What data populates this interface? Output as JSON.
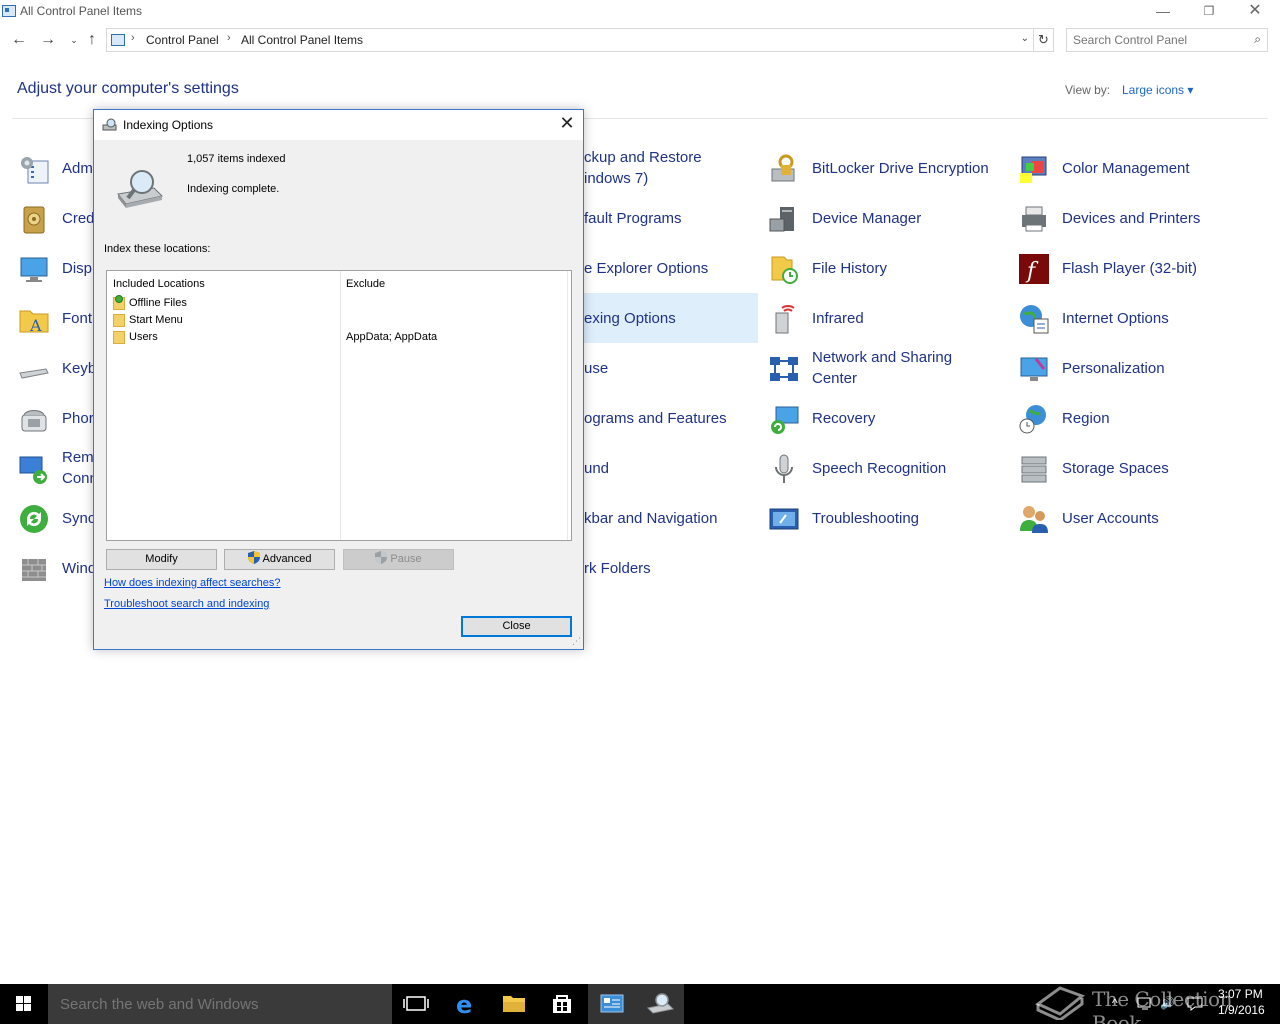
{
  "window": {
    "title": "All Control Panel Items",
    "min": "—",
    "max": "❐",
    "close": "✕"
  },
  "nav": {
    "back": "←",
    "forward": "→",
    "recent": "⌄",
    "up": "↑",
    "refresh": "↻",
    "dropdown": "⌄"
  },
  "address": {
    "crumbs": [
      "Control Panel",
      "All Control Panel Items"
    ],
    "separator": "›"
  },
  "search": {
    "placeholder": "Search Control Panel",
    "icon": "⌕"
  },
  "header": {
    "heading": "Adjust your computer's settings",
    "view_by_label": "View by:",
    "view_by_value": "Large icons ▾"
  },
  "cp_items": {
    "col1": [
      "Adm",
      "Cred",
      "Disp",
      "Font",
      "Keyb",
      "Phor",
      "Rem\nConn",
      "Sync",
      "Wind"
    ],
    "col2": [
      "ckup and Restore\nindows 7)",
      "fault Programs",
      "e Explorer Options",
      "exing Options",
      "use",
      "ograms and Features",
      "und",
      "kbar and Navigation",
      "rk Folders"
    ],
    "col3": [
      "BitLocker Drive Encryption",
      "Device Manager",
      "File History",
      "Infrared",
      "Network and Sharing\nCenter",
      "Recovery",
      "Speech Recognition",
      "Troubleshooting"
    ],
    "col4": [
      "Color Management",
      "Devices and Printers",
      "Flash Player (32-bit)",
      "Internet Options",
      "Personalization",
      "Region",
      "Storage Spaces",
      "User Accounts"
    ]
  },
  "dialog": {
    "title": "Indexing Options",
    "close": "✕",
    "items_indexed": "1,057 items indexed",
    "status": "Indexing complete.",
    "index_label": "Index these locations:",
    "columns": [
      "Included Locations",
      "Exclude"
    ],
    "rows": [
      {
        "name": "Offline Files",
        "exclude": ""
      },
      {
        "name": "Start Menu",
        "exclude": ""
      },
      {
        "name": "Users",
        "exclude": "AppData; AppData"
      }
    ],
    "buttons": {
      "modify": "Modify",
      "advanced": "Advanced",
      "pause": "Pause",
      "close": "Close"
    },
    "links": {
      "how": "How does indexing affect searches?",
      "troubleshoot": "Troubleshoot search and indexing"
    },
    "grip": "⋰"
  },
  "taskbar": {
    "search_placeholder": "Search the web and Windows",
    "time": "3:07 PM",
    "date": "1/9/2016",
    "tray_up": "^",
    "volume": "🔊",
    "watermark": "The Collection Book"
  }
}
